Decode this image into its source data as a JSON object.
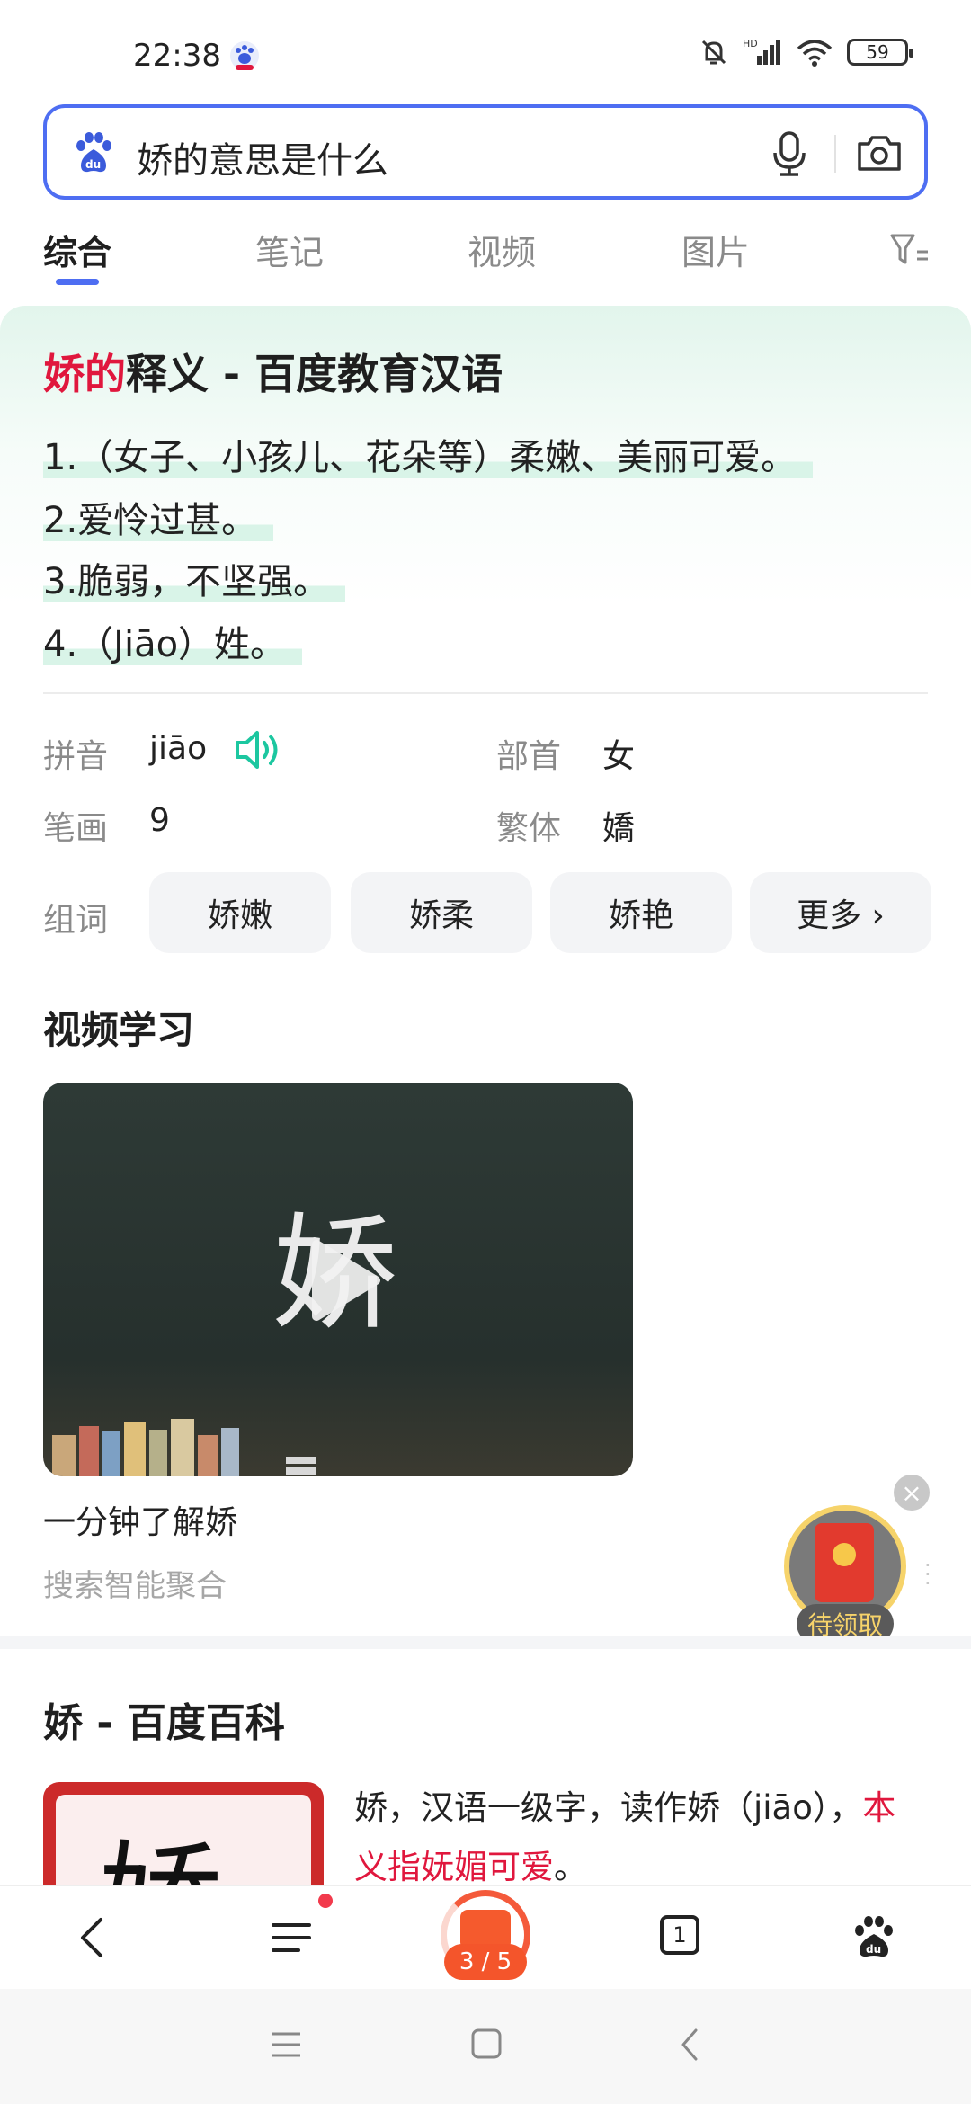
{
  "status": {
    "time": "22:38",
    "battery": "59"
  },
  "search": {
    "query": "娇的意思是什么"
  },
  "tabs": [
    {
      "label": "综合",
      "active": true
    },
    {
      "label": "笔记",
      "active": false
    },
    {
      "label": "视频",
      "active": false
    },
    {
      "label": "图片",
      "active": false
    }
  ],
  "definition": {
    "title_highlight": "娇的",
    "title_rest": "释义 - 百度教育汉语",
    "lines": [
      "1.（女子、小孩儿、花朵等）柔嫩、美丽可爱。",
      "2.爱怜过甚。",
      "3.脆弱，不坚强。",
      "4.（Jiāo）姓。"
    ]
  },
  "info": {
    "pinyin_label": "拼音",
    "pinyin_value": "jiāo",
    "radical_label": "部首",
    "radical_value": "女",
    "strokes_label": "笔画",
    "strokes_value": "9",
    "traditional_label": "繁体",
    "traditional_value": "嬌",
    "words_label": "组词",
    "words": [
      "娇嫩",
      "娇柔",
      "娇艳"
    ],
    "more": "更多 ›"
  },
  "video": {
    "section_title": "视频学习",
    "thumb_char": "娇",
    "caption": "一分钟了解娇",
    "source": "搜索智能聚合"
  },
  "floating": {
    "close": "×",
    "label": "待领取"
  },
  "baike": {
    "title": "娇 - 百度百科",
    "image_char": "娇",
    "line1_plain": "娇，汉语一级字，读作娇（jiāo），",
    "line1_red": "本",
    "line2_red": "义指妩媚可爱",
    "line2_end": "。"
  },
  "toolbar": {
    "progress": "3 / 5",
    "tab_count": "1"
  },
  "colors": {
    "accent": "#4e6ef2",
    "highlight_red": "#e0173d",
    "speaker_green": "#1cc7a0"
  }
}
